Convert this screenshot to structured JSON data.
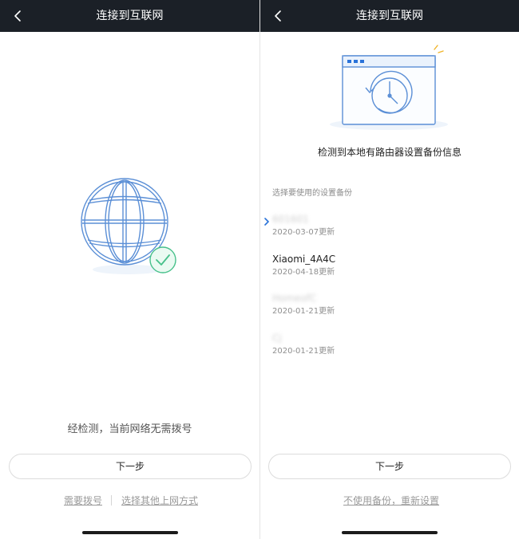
{
  "left": {
    "title": "连接到互联网",
    "status_text": "经检测，当前网络无需拨号",
    "next_button": "下一步",
    "links": {
      "dial": "需要拨号",
      "other": "选择其他上网方式"
    },
    "icon": "globe-check-icon"
  },
  "right": {
    "title": "连接到互联网",
    "headline": "检测到本地有路由器设置备份信息",
    "section_label": "选择要使用的设置备份",
    "backups": [
      {
        "name": "601601",
        "date": "2020-03-07更新"
      },
      {
        "name": "Xiaomi_4A4C",
        "date": "2020-04-18更新"
      },
      {
        "name": "HomeofC",
        "date": "2020-01-21更新"
      },
      {
        "name": "Cj",
        "date": "2020-01-21更新"
      }
    ],
    "next_button": "下一步",
    "reset_link": "不使用备份，重新设置",
    "icon": "browser-history-icon"
  },
  "colors": {
    "titlebar": "#1b2027",
    "globe": "#5b8fd6",
    "check": "#46c08a",
    "accent_blue": "#2a73d9",
    "muted_text": "#9a9a9a"
  }
}
